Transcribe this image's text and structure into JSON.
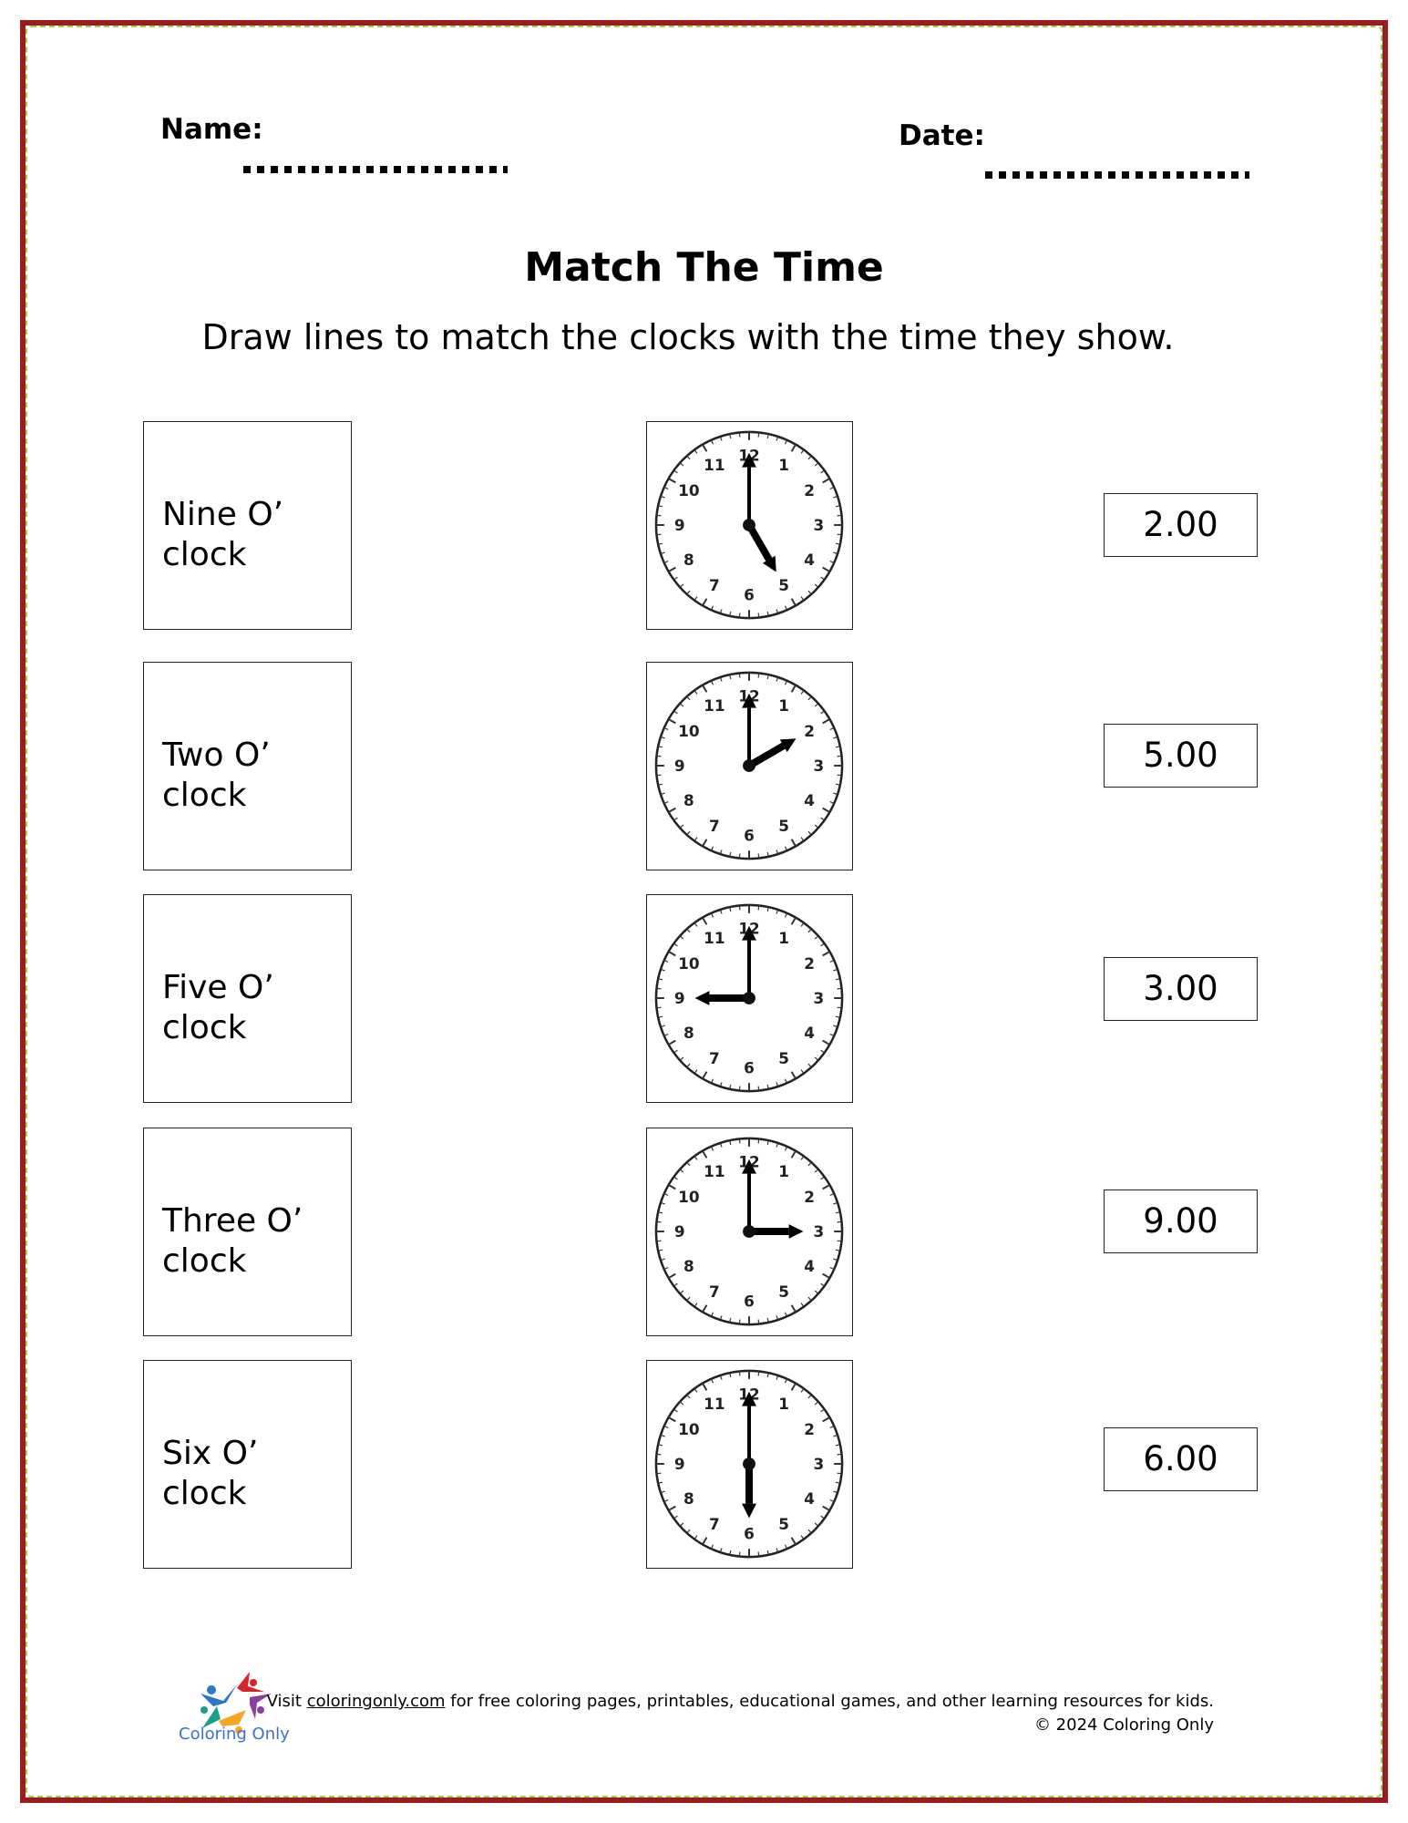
{
  "header": {
    "name_label": "Name:",
    "date_label": "Date:"
  },
  "title": "Match The Time",
  "instruction": "Draw lines to match the clocks with the time they show.",
  "words": [
    {
      "label": "Nine O’ clock"
    },
    {
      "label": "Two O’ clock"
    },
    {
      "label": "Five O’ clock"
    },
    {
      "label": "Three O’ clock"
    },
    {
      "label": "Six O’ clock"
    }
  ],
  "clocks": [
    {
      "shows": "5:00",
      "hour": 5,
      "minute": 0
    },
    {
      "shows": "2:00",
      "hour": 2,
      "minute": 0
    },
    {
      "shows": "9:00",
      "hour": 9,
      "minute": 0
    },
    {
      "shows": "3:00",
      "hour": 3,
      "minute": 0
    },
    {
      "shows": "6:00",
      "hour": 6,
      "minute": 0
    }
  ],
  "clock_numbers": [
    "12",
    "1",
    "2",
    "3",
    "4",
    "5",
    "6",
    "7",
    "8",
    "9",
    "10",
    "11"
  ],
  "times": [
    {
      "label": "2.00"
    },
    {
      "label": "5.00"
    },
    {
      "label": "3.00"
    },
    {
      "label": "9.00"
    },
    {
      "label": "6.00"
    }
  ],
  "footer": {
    "logo_text": "Coloring Only",
    "visit_prefix": "Visit ",
    "link_text": "coloringonly.com",
    "visit_suffix": " for free coloring pages, printables, educational games, and other learning resources for kids.",
    "copyright": "© 2024 Coloring Only"
  },
  "colors": {
    "border": "#9b1c1f",
    "inner_border": "#7ccf2a",
    "logo_text": "#3a6fd8"
  }
}
